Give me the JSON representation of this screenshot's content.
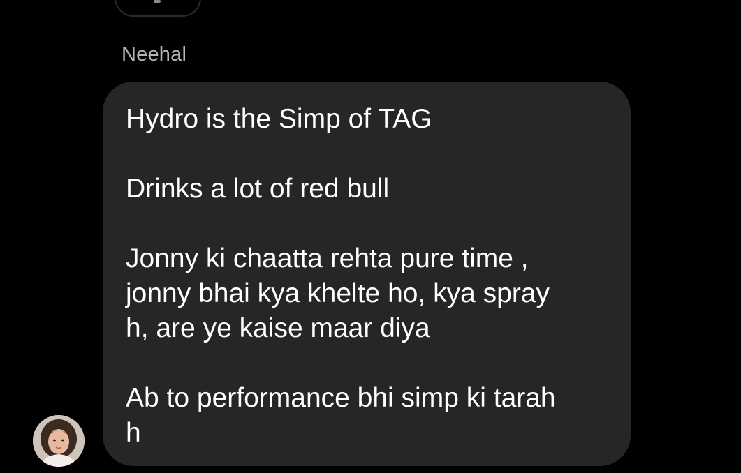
{
  "chat": {
    "sender_name": "Neehal",
    "avatar_icon": "profile-avatar",
    "message": {
      "paragraphs": [
        [
          "Hydro is the Simp of TAG"
        ],
        [
          "Drinks a lot of red bull"
        ],
        [
          "Jonny ki chaatta rehta pure time ,",
          "jonny bhai kya khelte ho, kya spray",
          "h, are ye kaise maar diya"
        ],
        [
          "Ab to performance bhi simp ki tarah",
          "h"
        ]
      ]
    }
  },
  "colors": {
    "background": "#000000",
    "bubble": "#262626",
    "message_text": "#ffffff",
    "sender_name_text": "#b5b5b5"
  }
}
